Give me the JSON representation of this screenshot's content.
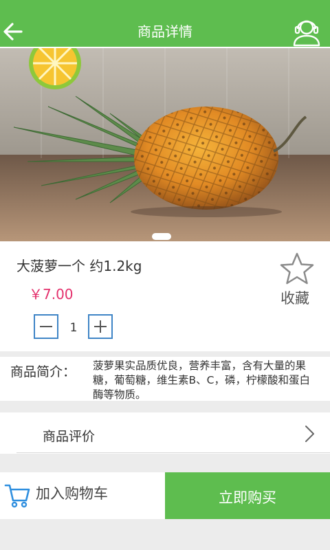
{
  "header": {
    "title": "商品详情",
    "back_icon": "back-arrow-icon",
    "service_icon": "customer-service-icon"
  },
  "banner": {
    "image": "pineapple-product-photo",
    "slides": 1,
    "active_slide": 1
  },
  "product": {
    "name": "大菠萝一个 约1.2kg",
    "price": "￥7.00",
    "favorite_label": "收藏",
    "favorite_icon": "star-outline-icon",
    "quantity": "1",
    "qty_minus_icon": "minus-icon",
    "qty_plus_icon": "plus-icon"
  },
  "intro": {
    "label": "商品简介：",
    "text": "菠萝果实品质优良，营养丰富，含有大量的果糖，葡萄糖，维生素B、C，磷，柠檬酸和蛋白酶等物质。"
  },
  "review": {
    "label": "商品评价",
    "arrow_icon": "chevron-right-icon"
  },
  "actions": {
    "add_cart_label": "加入购物车",
    "cart_icon": "shopping-cart-icon",
    "buy_now_label": "立即购买"
  },
  "colors": {
    "brand_green": "#5ebd4f",
    "price_pink": "#e4316d",
    "stepper_blue": "#3e84c6",
    "page_bg": "#ececec"
  }
}
